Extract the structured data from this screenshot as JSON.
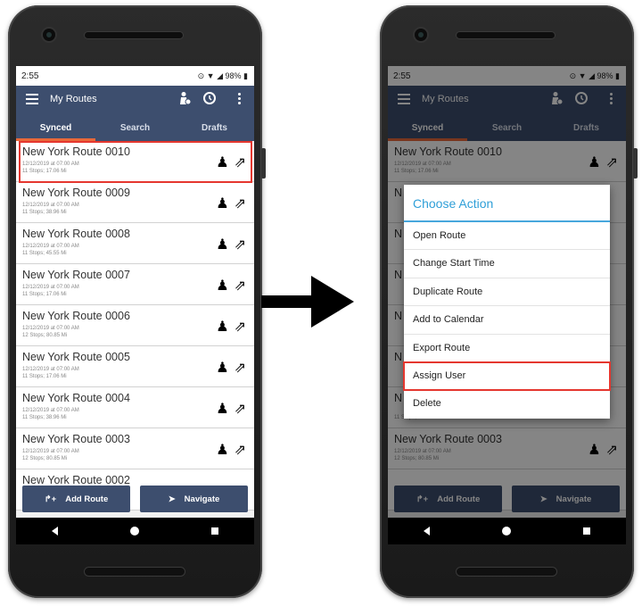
{
  "status": {
    "time": "2:55",
    "battery": "98%"
  },
  "app": {
    "title": "My Routes"
  },
  "tabs": [
    "Synced",
    "Search",
    "Drafts"
  ],
  "routes": [
    {
      "title": "New York Route 0010",
      "date": "12/12/2019 at 07:00 AM",
      "stats": "11 Stops; 17.06 Mi"
    },
    {
      "title": "New York Route 0009",
      "date": "12/12/2019 at 07:00 AM",
      "stats": "11 Stops; 38.96 Mi"
    },
    {
      "title": "New York Route 0008",
      "date": "12/12/2019 at 07:00 AM",
      "stats": "11 Stops; 45.55 Mi"
    },
    {
      "title": "New York Route 0007",
      "date": "12/12/2019 at 07:00 AM",
      "stats": "11 Stops; 17.06 Mi"
    },
    {
      "title": "New York Route 0006",
      "date": "12/12/2019 at 07:00 AM",
      "stats": "12 Stops; 80.85 Mi"
    },
    {
      "title": "New York Route 0005",
      "date": "12/12/2019 at 07:00 AM",
      "stats": "11 Stops; 17.06 Mi"
    },
    {
      "title": "New York Route 0004",
      "date": "12/12/2019 at 07:00 AM",
      "stats": "11 Stops; 38.96 Mi"
    },
    {
      "title": "New York Route 0003",
      "date": "12/12/2019 at 07:00 AM",
      "stats": "12 Stops; 80.85 Mi"
    },
    {
      "title": "New York Route 0002",
      "date": "",
      "stats": ""
    }
  ],
  "buttons": {
    "add_route": "Add Route",
    "navigate": "Navigate"
  },
  "dialog": {
    "title": "Choose Action",
    "items": [
      "Open Route",
      "Change Start Time",
      "Duplicate Route",
      "Add to Calendar",
      "Export Route",
      "Assign User",
      "Delete"
    ]
  },
  "right_visible": {
    "first_title": "New York Route 0010",
    "first_date": "12/12/2019 at 07:00 AM",
    "first_stats": "11 Stops; 17.06 Mi",
    "peek_letter": "N",
    "last_title": "New York Route 0003",
    "last_date": "12/12/2019 at 07:00 AM",
    "last_stats": "12 Stops; 80.85 Mi",
    "partial_stats": "11 Stops; 38.96 Mi"
  },
  "colors": {
    "appbar": "#3d4e6e",
    "tab_indicator": "#e8693a",
    "highlight": "#e5372f",
    "dialog_title": "#2f9fd8"
  }
}
